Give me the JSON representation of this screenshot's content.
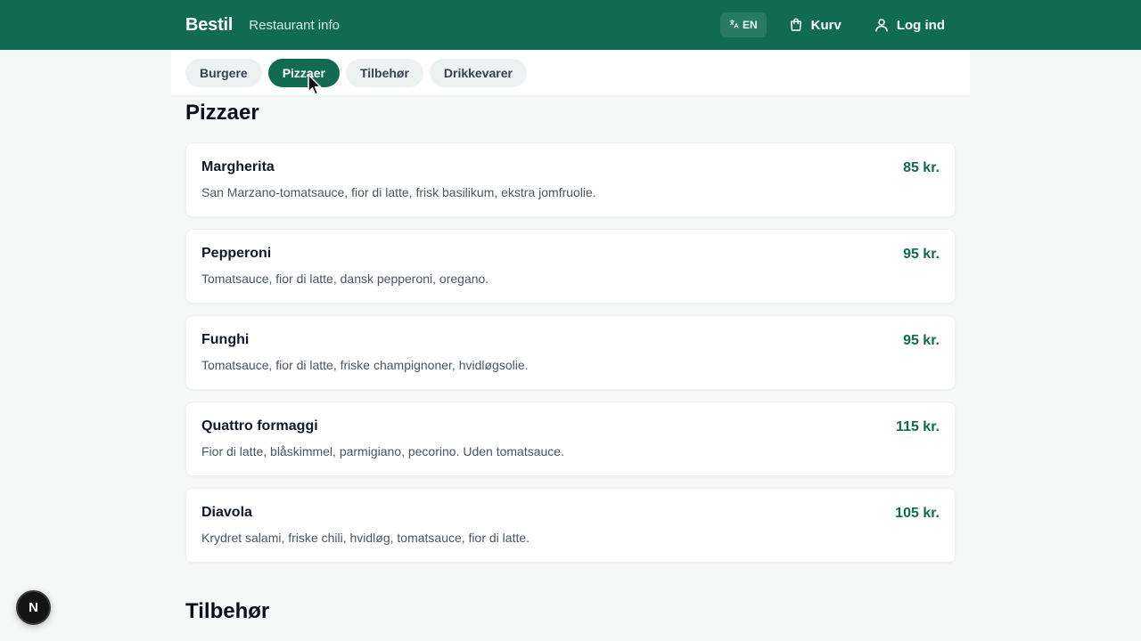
{
  "header": {
    "brand": "Bestil",
    "restaurant_link": "Restaurant info",
    "language_label": "EN",
    "cart_label": "Kurv",
    "login_label": "Log ind",
    "background_color": "#116b53"
  },
  "tabs": [
    {
      "label": "Burgere",
      "active": false
    },
    {
      "label": "Pizzaer",
      "active": true
    },
    {
      "label": "Tilbehør",
      "active": false
    },
    {
      "label": "Drikkevarer",
      "active": false
    }
  ],
  "sections": [
    {
      "title": "Pizzaer",
      "items": [
        {
          "name": "Margherita",
          "description": "San Marzano-tomatsauce, fior di latte, frisk basilikum, ekstra jomfruolie.",
          "price": "85 kr."
        },
        {
          "name": "Pepperoni",
          "description": "Tomatsauce, fior di latte, dansk pepperoni, oregano.",
          "price": "95 kr."
        },
        {
          "name": "Funghi",
          "description": "Tomatsauce, fior di latte, friske champignoner, hvidløgsolie.",
          "price": "95 kr."
        },
        {
          "name": "Quattro formaggi",
          "description": "Fior di latte, blåskimmel, parmigiano, pecorino. Uden tomatsauce.",
          "price": "115 kr."
        },
        {
          "name": "Diavola",
          "description": "Krydret salami, friske chili, hvidløg, tomatsauce, fior di latte.",
          "price": "105 kr."
        }
      ]
    },
    {
      "title": "Tilbehør",
      "items": []
    }
  ],
  "badge": {
    "label": "N"
  },
  "colors": {
    "accent": "#116b53",
    "price": "#116b53",
    "tab_inactive_bg": "#eef1f2"
  },
  "icons": {
    "language": "translate-icon",
    "cart": "shopping-bag-icon",
    "login": "user-icon"
  }
}
